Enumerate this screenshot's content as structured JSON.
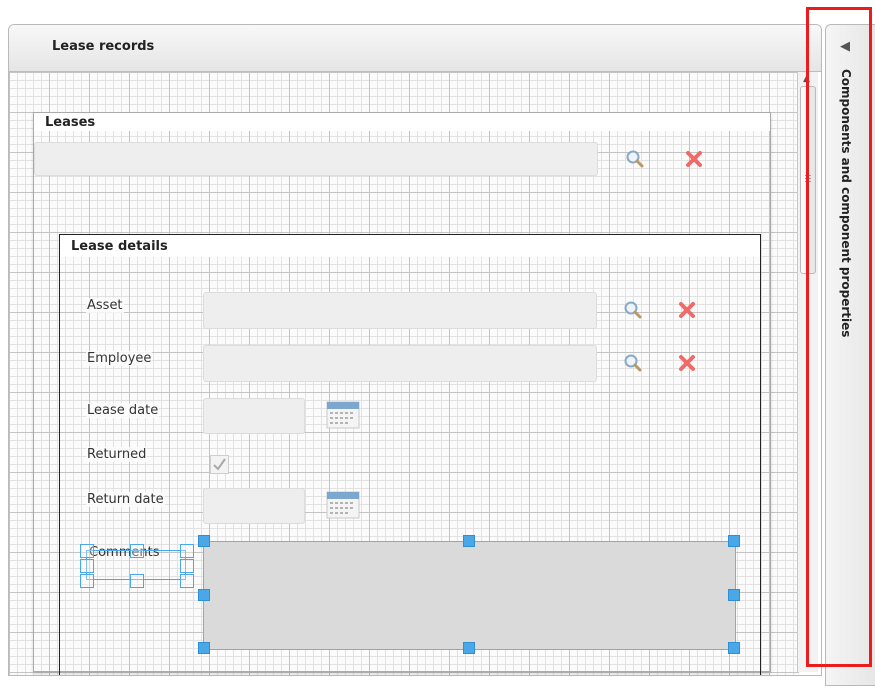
{
  "outer_panel": {
    "title": "Lease records"
  },
  "leases": {
    "title": "Leases",
    "field_value": ""
  },
  "details": {
    "title": "Lease details",
    "asset": {
      "label": "Asset",
      "value": ""
    },
    "employee": {
      "label": "Employee",
      "value": ""
    },
    "lease_date": {
      "label": "Lease date",
      "value": ""
    },
    "returned": {
      "label": "Returned",
      "checked": true
    },
    "return_date": {
      "label": "Return date",
      "value": ""
    },
    "comments": {
      "label": "Comments",
      "value": ""
    }
  },
  "right_panel": {
    "label": "Components and component properties",
    "collapse_glyph": "◀"
  },
  "scrollbar": {
    "up_glyph": "▲"
  },
  "colors": {
    "highlight_border": "#ec1c1c",
    "selection_handle": "#4aa8e8",
    "clear_icon": "#f06a6a"
  }
}
